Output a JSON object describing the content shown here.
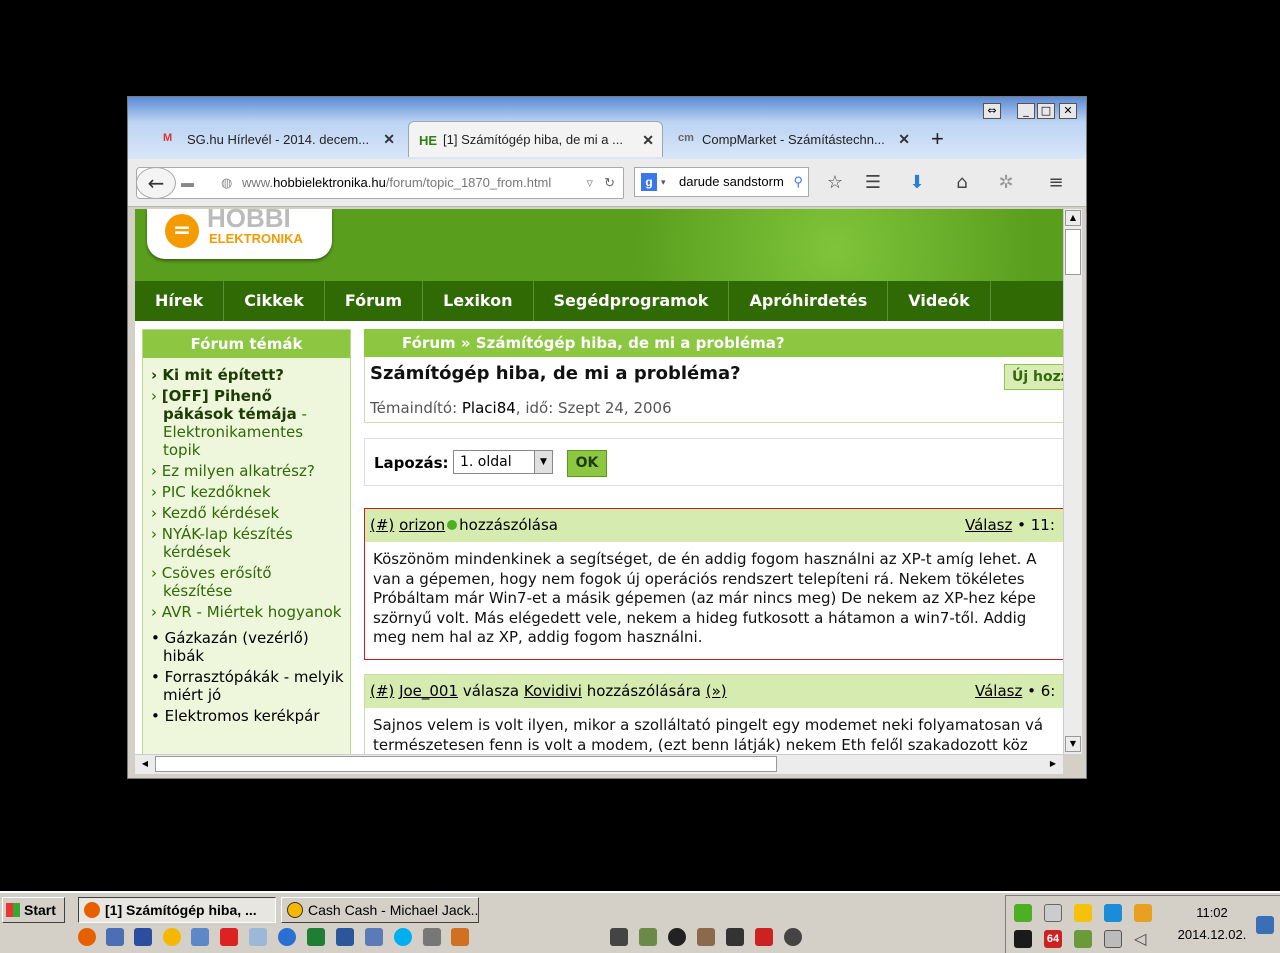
{
  "browser": {
    "tabs": [
      {
        "label": "SG.hu Hírlevél - 2014. decem...",
        "icon": "gmail-icon"
      },
      {
        "label": "[1] Számítógép hiba, de mi a ...",
        "icon": "he-icon",
        "badge": "HE"
      },
      {
        "label": "CompMarket - Számítástechn...",
        "icon": "compmarket-icon",
        "badge": "cm"
      }
    ],
    "url_prefix": "www.",
    "url_domain": "hobbielektronika.hu",
    "url_path": "/forum/topic_1870_from.html",
    "search_value": "darude sandstorm"
  },
  "site": {
    "logo_line1": "HOBBI",
    "logo_line2": "ELEKTRONIKA",
    "menu": [
      "Hírek",
      "Cikkek",
      "Fórum",
      "Lexikon",
      "Segédprogramok",
      "Apróhirdetés",
      "Videók"
    ]
  },
  "sidebar": {
    "title": "Fórum témák",
    "items": [
      {
        "text": "Ki mit épített?",
        "bold": true,
        "bullet": "›"
      },
      {
        "text": "[OFF] Pihenő pákások témája",
        "suffix": " - Elektronikamentes topik",
        "bold": true,
        "bullet": "›"
      },
      {
        "text": "Ez milyen alkatrész?",
        "bullet": "›"
      },
      {
        "text": "PIC kezdőknek",
        "bullet": "›"
      },
      {
        "text": "Kezdő kérdések",
        "bullet": "›"
      },
      {
        "text": "NYÁK-lap készítés kérdések",
        "bullet": "›"
      },
      {
        "text": "Csöves erősítő készítése",
        "bullet": "›"
      },
      {
        "text": "AVR - Miértek hogyanok",
        "bullet": "›"
      },
      {
        "text": "Gázkazán (vezérlő) hibák",
        "bullet": "•"
      },
      {
        "text": "Forrasztópákák - melyik miért jó",
        "bullet": "•"
      },
      {
        "text": "Elektromos kerékpár",
        "bullet": "•"
      }
    ]
  },
  "main": {
    "breadcrumb": "Fórum » Számítógép hiba, de mi a probléma?",
    "topic_title": "Számítógép hiba, de mi a probléma?",
    "starter_label": "Témaindító: ",
    "starter_name": "Placi84",
    "starter_date": ", idő: Szept 24, 2006",
    "new_button": "Új hozzászólás",
    "pager_label": "Lapozás:",
    "pager_value": "1. oldal",
    "pager_ok": "OK",
    "posts": [
      {
        "hash": "(#)",
        "author": "orizon",
        "action": "hozzászólása",
        "reply": "Válasz",
        "time": "11:",
        "lines": [
          "Köszönöm mindenkinek a segítséget, de én addig fogom használni az XP-t amíg lehet. A",
          "van a gépemen, hogy nem fogok új operációs rendszert telepíteni rá. Nekem tökéletes",
          "Próbáltam már Win7-et a másik gépemen (az már nincs meg) De nekem az XP-hez képe",
          "szörnyű volt. Más elégedett vele, nekem a hideg futkosott a hátamon a win7-től. Addig",
          "meg nem hal az XP, addig fogom használni."
        ]
      },
      {
        "hash": "(#)",
        "author": "Joe_001",
        "action": "válasza",
        "ref_author": "Kovidivi",
        "ref_action": "hozzászólására",
        "ref_link": "(»)",
        "reply": "Válasz",
        "time": "6:",
        "lines": [
          "Sajnos velem is volt ilyen, mikor a szolláltató pingelt egy modemet neki folyamatosan vá",
          "természetesen fenn is volt a modem, (ezt benn látják) nekem Eth felől szakadozott köz"
        ]
      }
    ]
  },
  "taskbar": {
    "start": "Start",
    "windows": [
      "[1] Számítógép hiba, ...",
      "Cash Cash - Michael Jack..."
    ],
    "clock_time": "11:02",
    "clock_date": "2014.12.02.",
    "tray_badge": "64"
  }
}
